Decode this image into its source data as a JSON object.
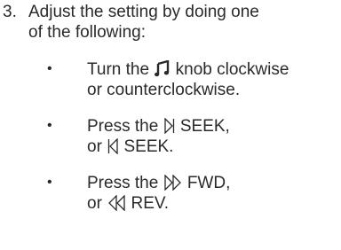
{
  "step": {
    "number": "3.",
    "text_line1": "Adjust the setting by doing one",
    "text_line2": "of the following:"
  },
  "bullet_symbol": "•",
  "items": [
    {
      "line1_before": "Turn the",
      "icon": "music-note-icon",
      "line1_after": "knob clockwise",
      "line2": "or counterclockwise."
    },
    {
      "line1_before": "Press the",
      "icon": "seek-forward-icon",
      "line1_after": "SEEK,",
      "line2_before": "or",
      "line2_icon": "seek-back-icon",
      "line2_after": "SEEK."
    },
    {
      "line1_before": "Press the",
      "icon": "fast-forward-icon",
      "line1_after": "FWD,",
      "line2_before": "or",
      "line2_icon": "rewind-icon",
      "line2_after": "REV."
    }
  ],
  "colors": {
    "text": "#2a2a2a"
  }
}
